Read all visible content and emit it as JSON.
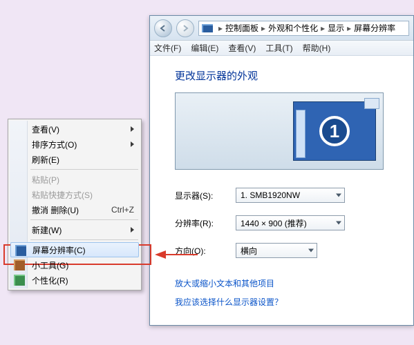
{
  "window": {
    "breadcrumbs": [
      "控制面板",
      "外观和个性化",
      "显示",
      "屏幕分辨率"
    ],
    "menubar": {
      "file": "文件(F)",
      "edit": "编辑(E)",
      "view": "查看(V)",
      "tools": "工具(T)",
      "help": "帮助(H)"
    },
    "page_title": "更改显示器的外观",
    "monitor_number": "1",
    "fields": {
      "display_label": "显示器(S):",
      "display_value": "1. SMB1920NW",
      "resolution_label": "分辨率(R):",
      "resolution_value": "1440 × 900 (推荐)",
      "orientation_label": "方向(O):",
      "orientation_value": "横向"
    },
    "links": {
      "scale_text": "放大或缩小文本和其他项目",
      "which_settings": "我应该选择什么显示器设置？"
    }
  },
  "context_menu": {
    "view": "查看(V)",
    "sort": "排序方式(O)",
    "refresh": "刷新(E)",
    "paste": "粘贴(P)",
    "paste_shortcut": "粘贴快捷方式(S)",
    "undo_delete": "撤消 删除(U)",
    "undo_shortcut": "Ctrl+Z",
    "new": "新建(W)",
    "screen_res": "屏幕分辨率(C)",
    "gadgets": "小工具(G)",
    "personalize": "个性化(R)"
  }
}
